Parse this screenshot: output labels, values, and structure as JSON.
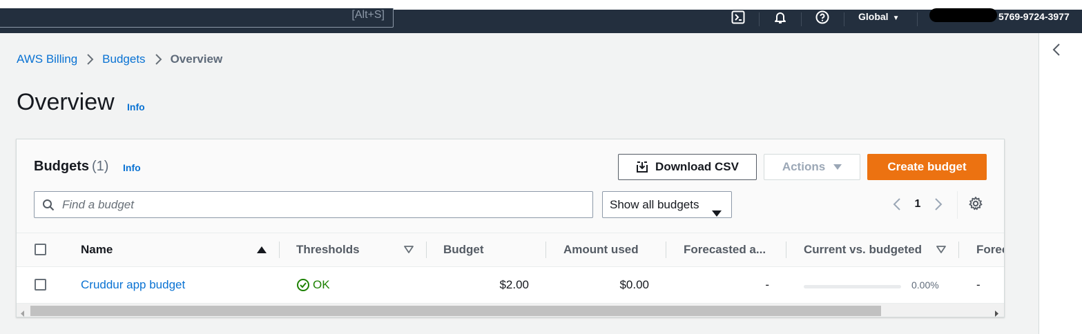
{
  "topbar": {
    "search_hint": "[Alt+S]",
    "icons": [
      "cloudshell-icon",
      "bell-icon",
      "help-icon"
    ],
    "region_label": "Global",
    "account_id": "5769-9724-3977"
  },
  "breadcrumb": {
    "items": [
      "AWS Billing",
      "Budgets"
    ],
    "current": "Overview"
  },
  "page": {
    "title": "Overview",
    "info": "Info"
  },
  "budgets_panel": {
    "title": "Budgets",
    "count": "(1)",
    "info": "Info",
    "download_label": "Download CSV",
    "actions_label": "Actions",
    "create_label": "Create budget",
    "search_placeholder": "Find a budget",
    "filter_selected": "Show all budgets",
    "page_number": "1",
    "columns": [
      "Name",
      "Thresholds",
      "Budget",
      "Amount used",
      "Forecasted a...",
      "Current vs. budgeted",
      "Forec"
    ],
    "rows": [
      {
        "name": "Cruddur app budget",
        "thresholds": "OK",
        "budget": "$2.00",
        "amount_used": "$0.00",
        "forecasted": "-",
        "current_vs_budgeted_pct": "0.00%",
        "current_vs_budgeted_fraction": 0,
        "forecasted_vs": "-"
      }
    ]
  },
  "colors": {
    "topbar_bg": "#232f3e",
    "link": "#0972d3",
    "primary": "#ec7211",
    "ok": "#1d8102",
    "page_bg": "#f2f3f3"
  }
}
